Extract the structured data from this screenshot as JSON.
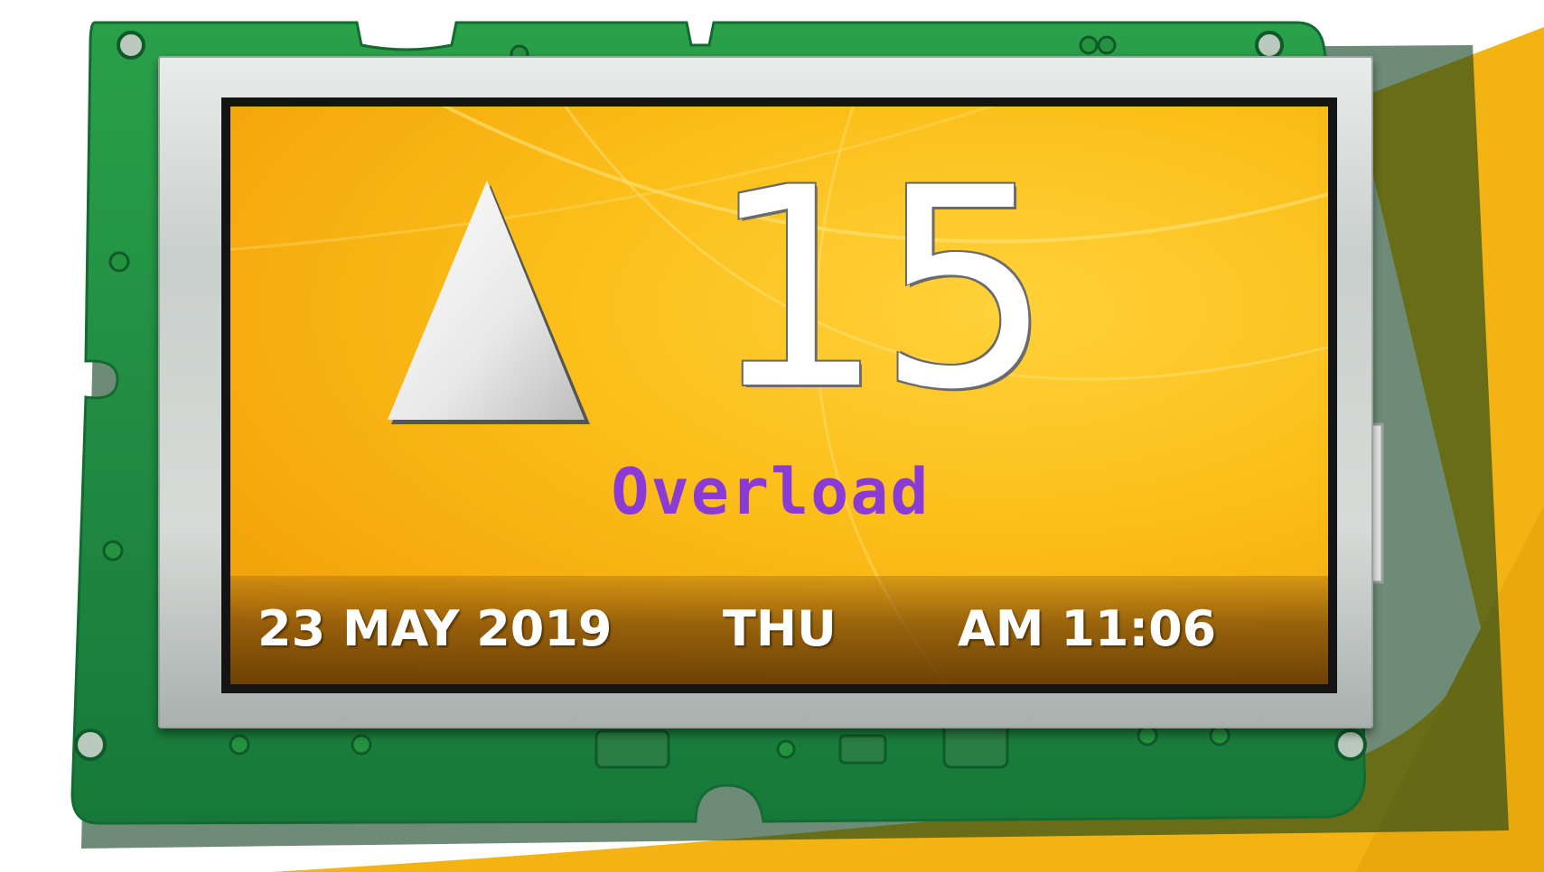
{
  "display": {
    "direction": "up",
    "floor": "15",
    "status": "Overload",
    "date": "23 MAY 2019",
    "day": "THU",
    "time": "AM 11:06"
  },
  "colors": {
    "screen": "#f7b514",
    "status_text": "#8a3bd6",
    "pcb": "#1f8f3c",
    "bezel": "#d0d5d2"
  },
  "icons": {
    "direction_icon": "up-triangle-icon"
  }
}
